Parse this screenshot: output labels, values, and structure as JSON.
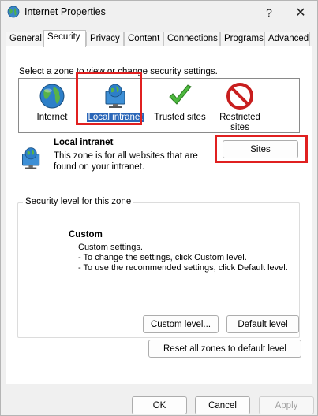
{
  "window": {
    "title": "Internet Properties",
    "help": "?",
    "close": "✕"
  },
  "tabs": [
    {
      "label": "General"
    },
    {
      "label": "Security"
    },
    {
      "label": "Privacy"
    },
    {
      "label": "Content"
    },
    {
      "label": "Connections"
    },
    {
      "label": "Programs"
    },
    {
      "label": "Advanced"
    }
  ],
  "security": {
    "prompt": "Select a zone to view or change security settings.",
    "zones": [
      {
        "label": "Internet",
        "icon": "globe-icon"
      },
      {
        "label": "Local intranet",
        "icon": "monitor-globe-icon"
      },
      {
        "label": "Trusted sites",
        "icon": "checkmark-icon"
      },
      {
        "label": "Restricted sites",
        "icon": "no-entry-icon"
      }
    ],
    "selected_zone": {
      "name": "Local intranet",
      "description": "This zone is for all websites that are found on your intranet.",
      "sites_button": "Sites"
    },
    "level_group": {
      "legend": "Security level for this zone",
      "title": "Custom",
      "lines": [
        "Custom settings.",
        "- To change the settings, click Custom level.",
        "- To use the recommended settings, click Default level."
      ],
      "custom_level_button": "Custom level...",
      "default_level_button": "Default level"
    },
    "reset_button": "Reset all zones to default level"
  },
  "footer": {
    "ok": "OK",
    "cancel": "Cancel",
    "apply": "Apply"
  },
  "colors": {
    "highlight": "#e02020",
    "selection": "#2a66b8"
  }
}
